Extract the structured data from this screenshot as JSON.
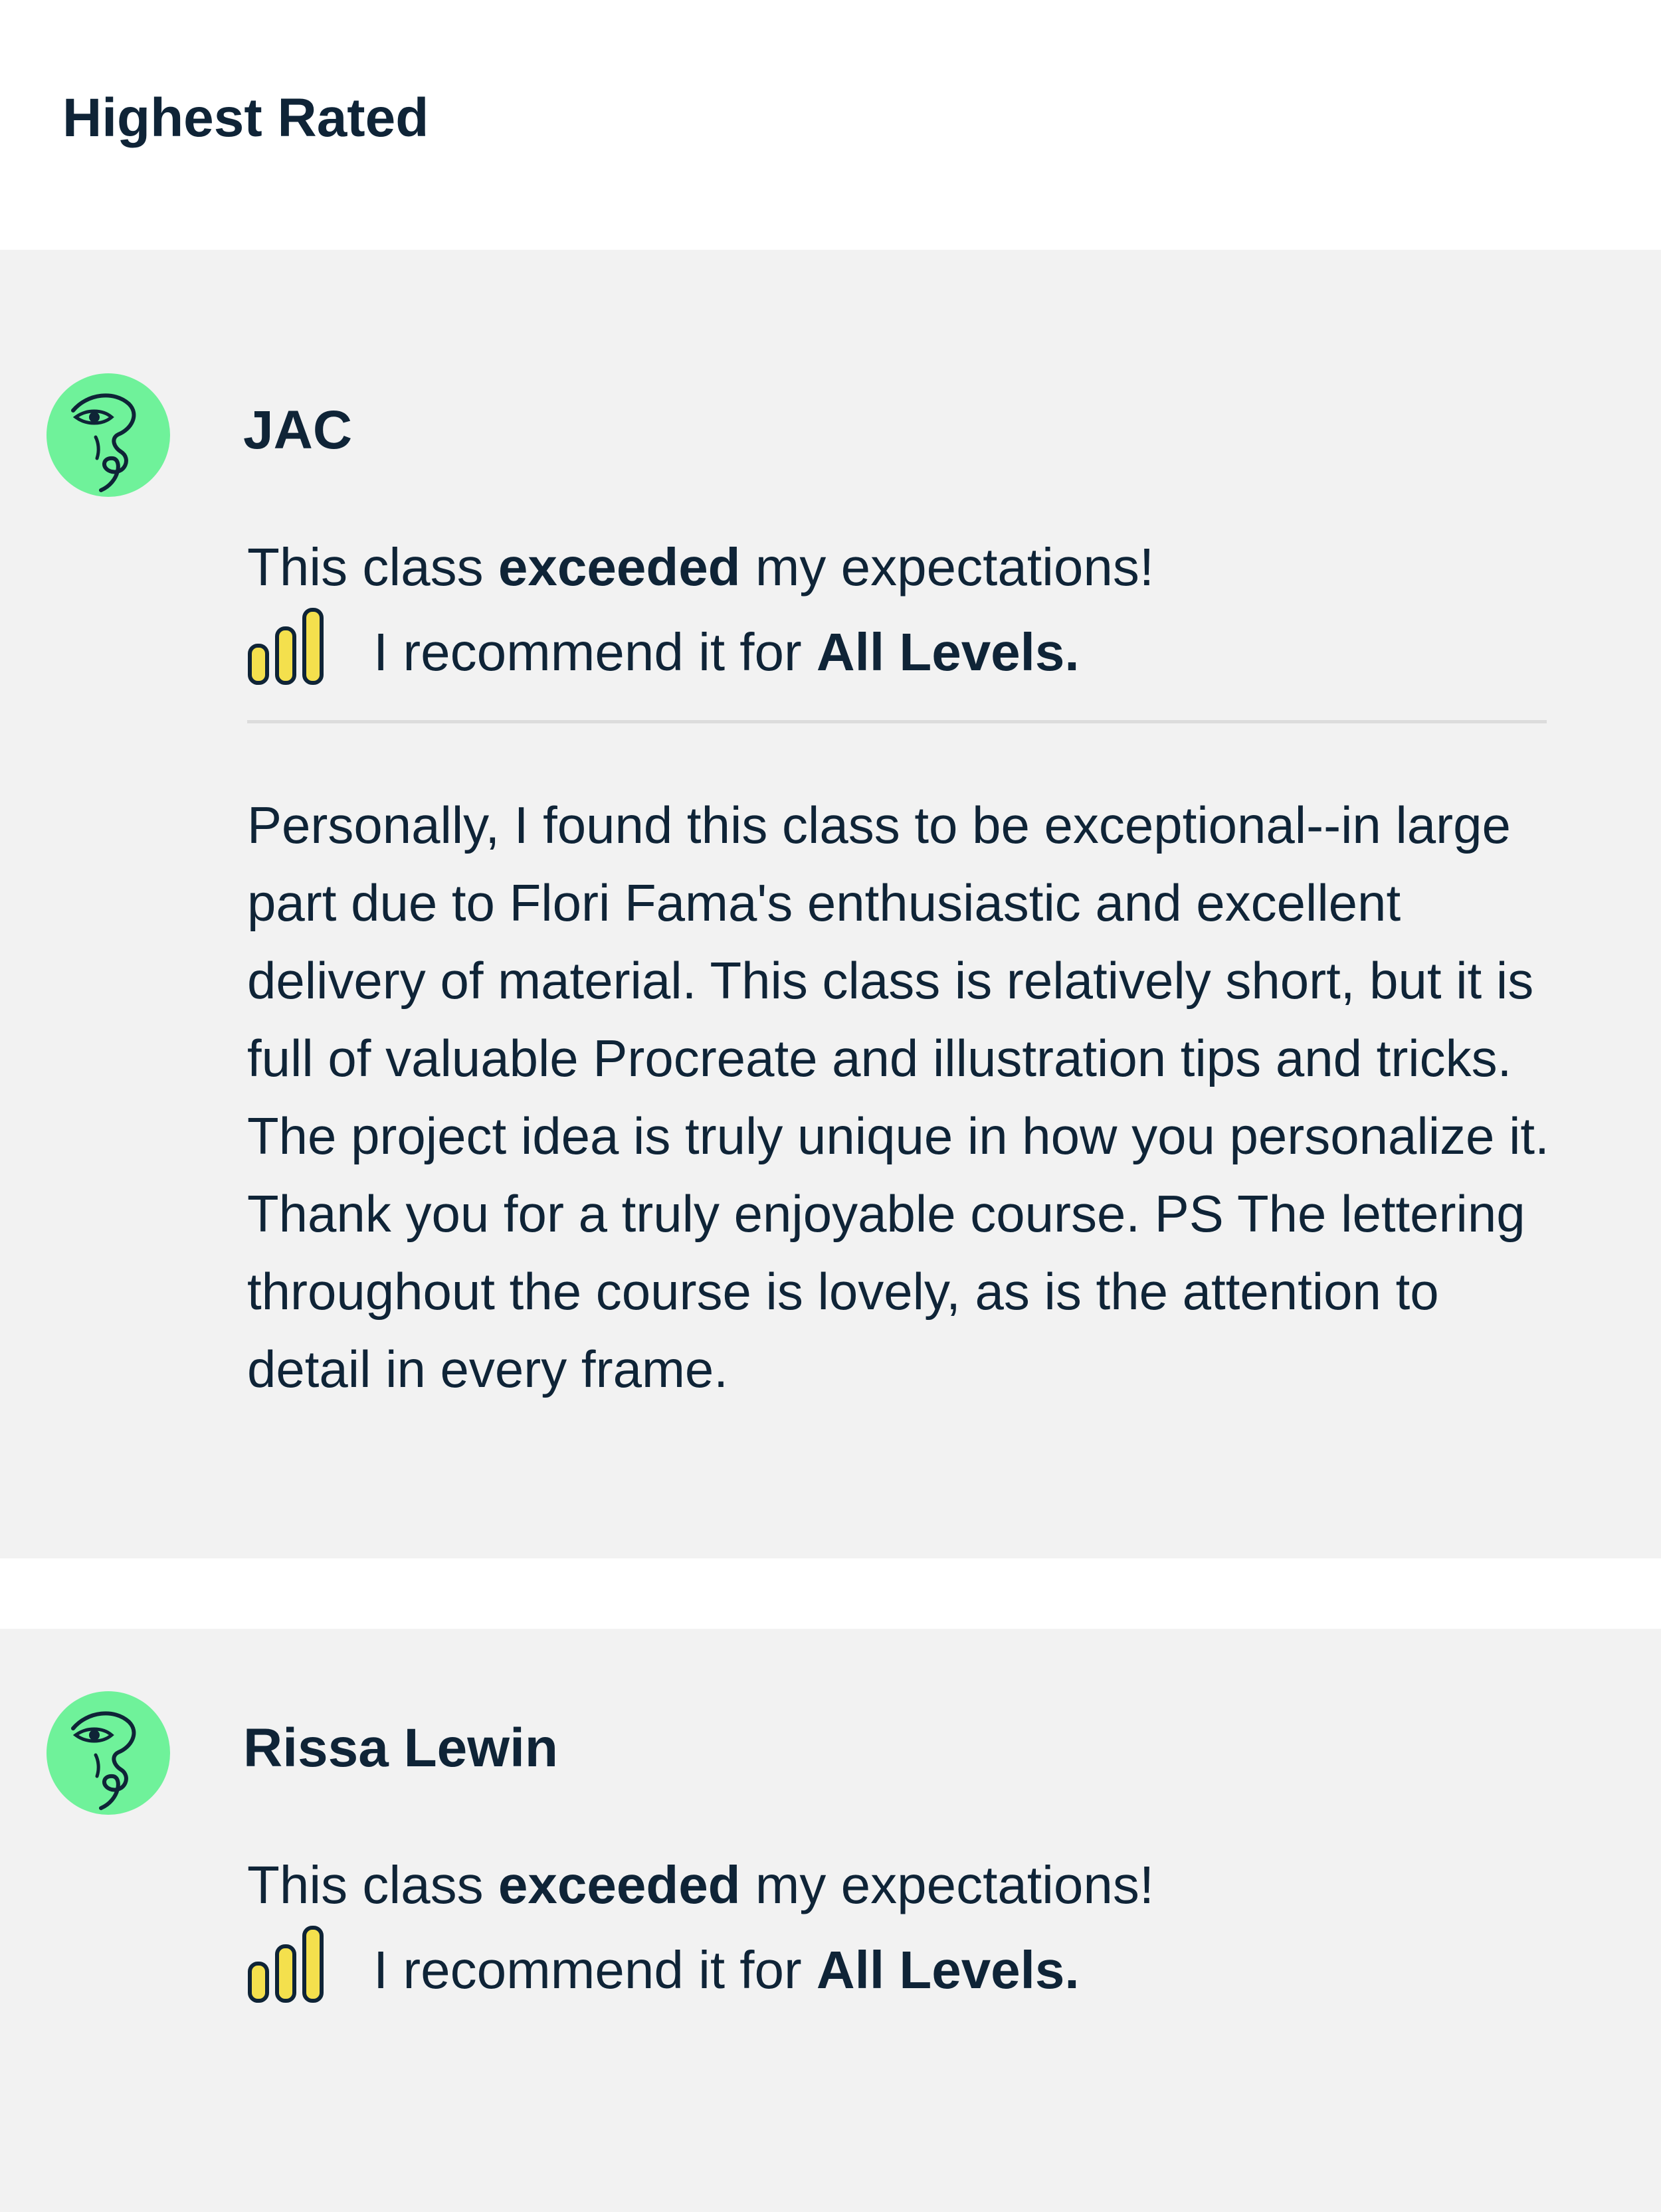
{
  "section": {
    "title": "Highest Rated"
  },
  "reviews": [
    {
      "name": "JAC",
      "expectation": {
        "prefix": "This class ",
        "emphasis": "exceeded",
        "suffix": " my expectations!"
      },
      "level": {
        "prefix": "I recommend it for ",
        "value": "All Levels."
      },
      "body": "Personally, I found this class to be exceptional--in large part due to Flori Fama's enthusiastic and excellent delivery of material. This class is relatively short, but it is full of valuable Procreate and illustration tips and tricks. The project idea is truly unique in how you personalize it. Thank you for a truly enjoyable course. PS The lettering throughout the course is lovely, as is the attention to detail in every frame."
    },
    {
      "name": "Rissa Lewin",
      "expectation": {
        "prefix": "This class ",
        "emphasis": "exceeded",
        "suffix": " my expectations!"
      },
      "level": {
        "prefix": "I recommend it for ",
        "value": "All Levels."
      }
    }
  ],
  "colors": {
    "text": "#0f2437",
    "card_background": "#f2f2f2",
    "avatar_green": "#6ff29a",
    "level_bar_yellow": "#f4e04d",
    "divider": "#dcdcdc"
  },
  "icons": {
    "avatar": "face-line-drawing-avatar",
    "level": "signal-bars-level-icon"
  }
}
